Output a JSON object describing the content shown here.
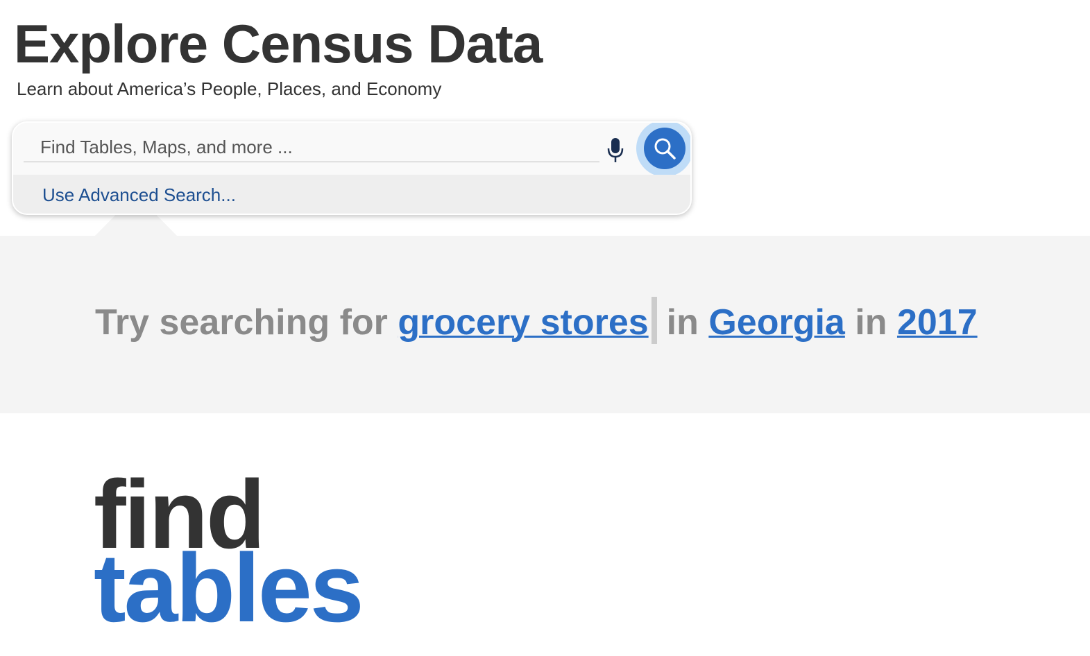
{
  "header": {
    "title": "Explore Census Data",
    "subtitle": "Learn about America’s People, Places, and Economy"
  },
  "search": {
    "placeholder": "Find Tables, Maps, and more ...",
    "advanced_label": "Use Advanced Search..."
  },
  "suggestion": {
    "prefix": "Try searching for",
    "topic": "grocery stores",
    "in1": "in",
    "place": "Georgia",
    "in2": "in",
    "year": "2017"
  },
  "hero": {
    "line1": "find",
    "line2": "tables"
  },
  "colors": {
    "accent": "#2c6fc6",
    "text": "#333333",
    "band": "#f4f4f4"
  }
}
